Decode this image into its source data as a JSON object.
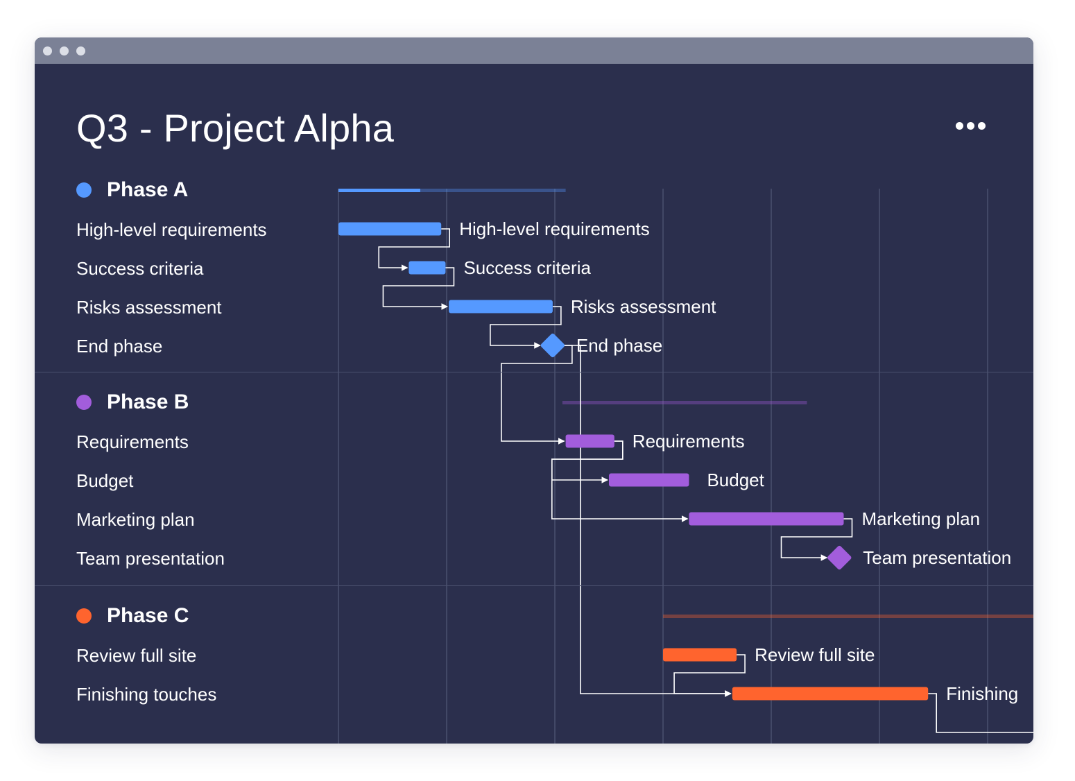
{
  "window": {
    "title": "Q3 - Project Alpha",
    "menu_icon": "more-horizontal-icon"
  },
  "colors": {
    "background": "#2b2f4d",
    "titlebar": "#7b8196",
    "grid": "#4b506e",
    "phase_a": "#5599ff",
    "phase_b": "#a25ddc",
    "phase_c": "#ff642e",
    "connector": "#ffffff"
  },
  "timeline": {
    "grid_columns": 7
  },
  "phases": [
    {
      "id": "a",
      "label": "Phase A",
      "color": "#5599ff",
      "summary_track": [
        0,
        2.1
      ],
      "summary_progress": 0.36,
      "tasks": [
        {
          "label": "High-level requirements",
          "bar_label": "High-level requirements",
          "type": "task",
          "start": 0,
          "end": 0.95
        },
        {
          "label": "Success criteria",
          "bar_label": "Success criteria",
          "type": "task",
          "start": 0.65,
          "end": 0.99
        },
        {
          "label": "Risks assessment",
          "bar_label": "Risks assessment",
          "type": "task",
          "start": 1.02,
          "end": 1.98
        },
        {
          "label": "End phase",
          "bar_label": "End phase",
          "type": "milestone",
          "at": 1.98
        }
      ]
    },
    {
      "id": "b",
      "label": "Phase B",
      "color": "#a25ddc",
      "summary_track": [
        2.07,
        4.33
      ],
      "summary_progress": 1,
      "tasks": [
        {
          "label": "Requirements",
          "bar_label": "Requirements",
          "type": "task",
          "start": 2.1,
          "end": 2.55
        },
        {
          "label": "Budget",
          "bar_label": "Budget",
          "type": "task",
          "start": 2.5,
          "end": 3.24
        },
        {
          "label": "Marketing plan",
          "bar_label": "Marketing plan",
          "type": "task",
          "start": 3.24,
          "end": 4.67
        },
        {
          "label": "Team presentation",
          "bar_label": "Team presentation",
          "type": "milestone",
          "at": 4.63
        }
      ]
    },
    {
      "id": "c",
      "label": "Phase C",
      "color": "#ff642e",
      "summary_track": [
        3.0,
        6.5
      ],
      "summary_progress": 1,
      "tasks": [
        {
          "label": "Review full site",
          "bar_label": "Review full site",
          "type": "task",
          "start": 3.0,
          "end": 3.68
        },
        {
          "label": "Finishing touches",
          "bar_label": "Finishing",
          "type": "task",
          "start": 3.64,
          "end": 5.45
        }
      ]
    }
  ],
  "dependencies": [
    [
      "a",
      0,
      "a",
      1
    ],
    [
      "a",
      1,
      "a",
      2
    ],
    [
      "a",
      2,
      "a",
      3
    ],
    [
      "a",
      3,
      "b",
      0
    ],
    [
      "a",
      3,
      "c",
      1
    ],
    [
      "b",
      0,
      "b",
      1
    ],
    [
      "b",
      0,
      "b",
      2
    ],
    [
      "b",
      2,
      "b",
      3
    ],
    [
      "c",
      0,
      "c",
      1
    ]
  ]
}
